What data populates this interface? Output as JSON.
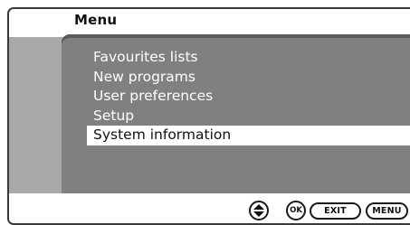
{
  "header": {
    "title": "Menu"
  },
  "menu": {
    "items": [
      {
        "label": "Favourites lists",
        "selected": false
      },
      {
        "label": "New programs",
        "selected": false
      },
      {
        "label": "User preferences",
        "selected": false
      },
      {
        "label": "Setup",
        "selected": false
      },
      {
        "label": "System information",
        "selected": true
      }
    ]
  },
  "footer": {
    "navigate_icon": "up-down-arrows-icon",
    "ok_label": "OK",
    "exit_label": "EXIT",
    "menu_label": "MENU"
  },
  "colors": {
    "panel": "#808080",
    "side_band": "#a9a9a9",
    "selection": "#ffffff",
    "border": "#3a3a3a"
  }
}
